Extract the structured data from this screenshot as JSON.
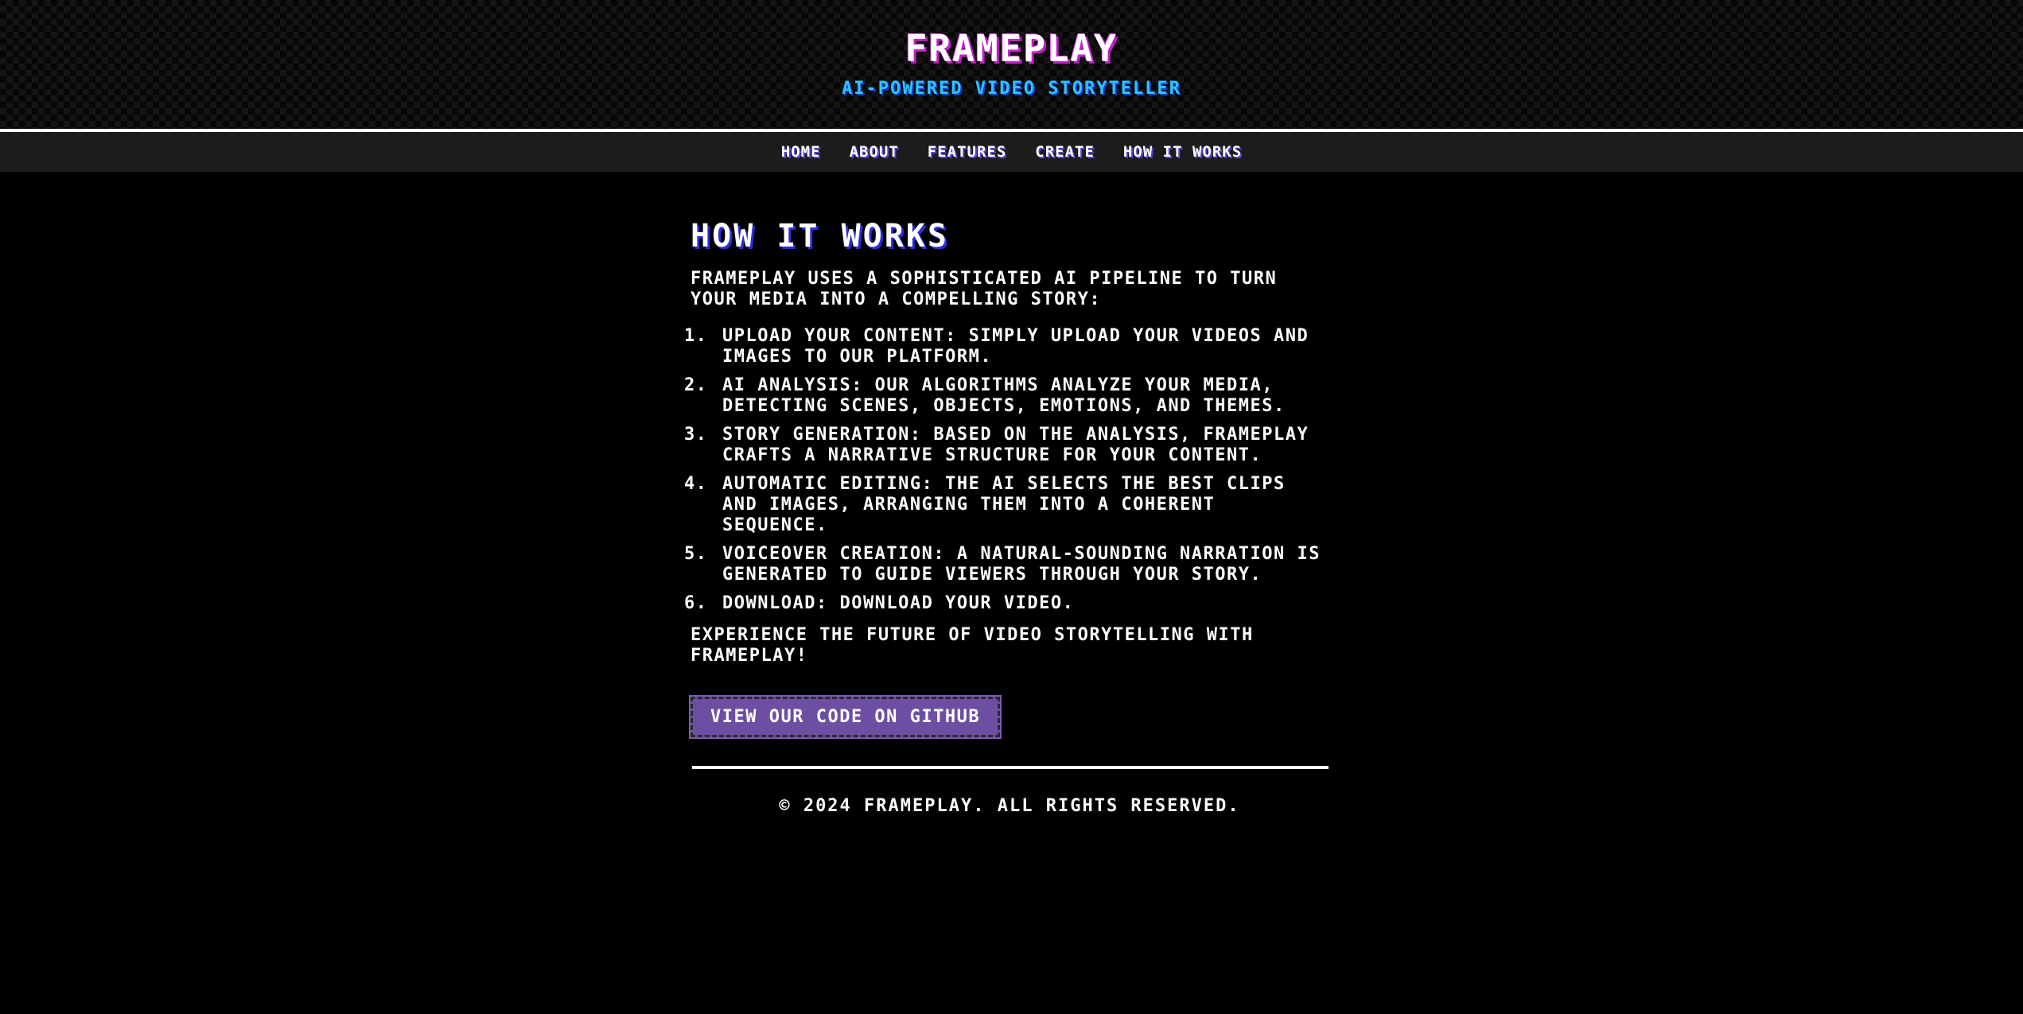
{
  "header": {
    "title": "FRAMEPLAY",
    "tagline": "AI-POWERED VIDEO STORYTELLER"
  },
  "nav": {
    "items": [
      {
        "label": "HOME"
      },
      {
        "label": "ABOUT"
      },
      {
        "label": "FEATURES"
      },
      {
        "label": "CREATE"
      },
      {
        "label": "HOW IT WORKS"
      }
    ]
  },
  "main": {
    "heading": "HOW IT WORKS",
    "intro": "FRAMEPLAY USES A SOPHISTICATED AI PIPELINE TO TURN YOUR MEDIA INTO A COMPELLING STORY:",
    "steps": [
      {
        "num": "1.",
        "text": "UPLOAD YOUR CONTENT: SIMPLY UPLOAD YOUR VIDEOS AND IMAGES TO OUR PLATFORM."
      },
      {
        "num": "2.",
        "text": "AI ANALYSIS: OUR ALGORITHMS ANALYZE YOUR MEDIA, DETECTING SCENES, OBJECTS, EMOTIONS, AND THEMES."
      },
      {
        "num": "3.",
        "text": "STORY GENERATION: BASED ON THE ANALYSIS, FRAMEPLAY CRAFTS A NARRATIVE STRUCTURE FOR YOUR CONTENT."
      },
      {
        "num": "4.",
        "text": "AUTOMATIC EDITING: THE AI SELECTS THE BEST CLIPS AND IMAGES, ARRANGING THEM INTO A COHERENT SEQUENCE."
      },
      {
        "num": "5.",
        "text": "VOICEOVER CREATION: A NATURAL-SOUNDING NARRATION IS GENERATED TO GUIDE VIEWERS THROUGH YOUR STORY."
      },
      {
        "num": "6.",
        "text": "DOWNLOAD: DOWNLOAD YOUR VIDEO."
      }
    ],
    "outro": "EXPERIENCE THE FUTURE OF VIDEO STORYTELLING WITH FRAMEPLAY!",
    "github_button": "VIEW OUR CODE ON GITHUB"
  },
  "footer": {
    "copyright": "© 2024 FRAMEPLAY. ALL RIGHTS RESERVED."
  },
  "colors": {
    "background": "#000000",
    "title_shadow": "#c21fc9",
    "tagline": "#2ec4ff",
    "nav_background": "#1c1c1c",
    "button": "#6c4fa3"
  }
}
